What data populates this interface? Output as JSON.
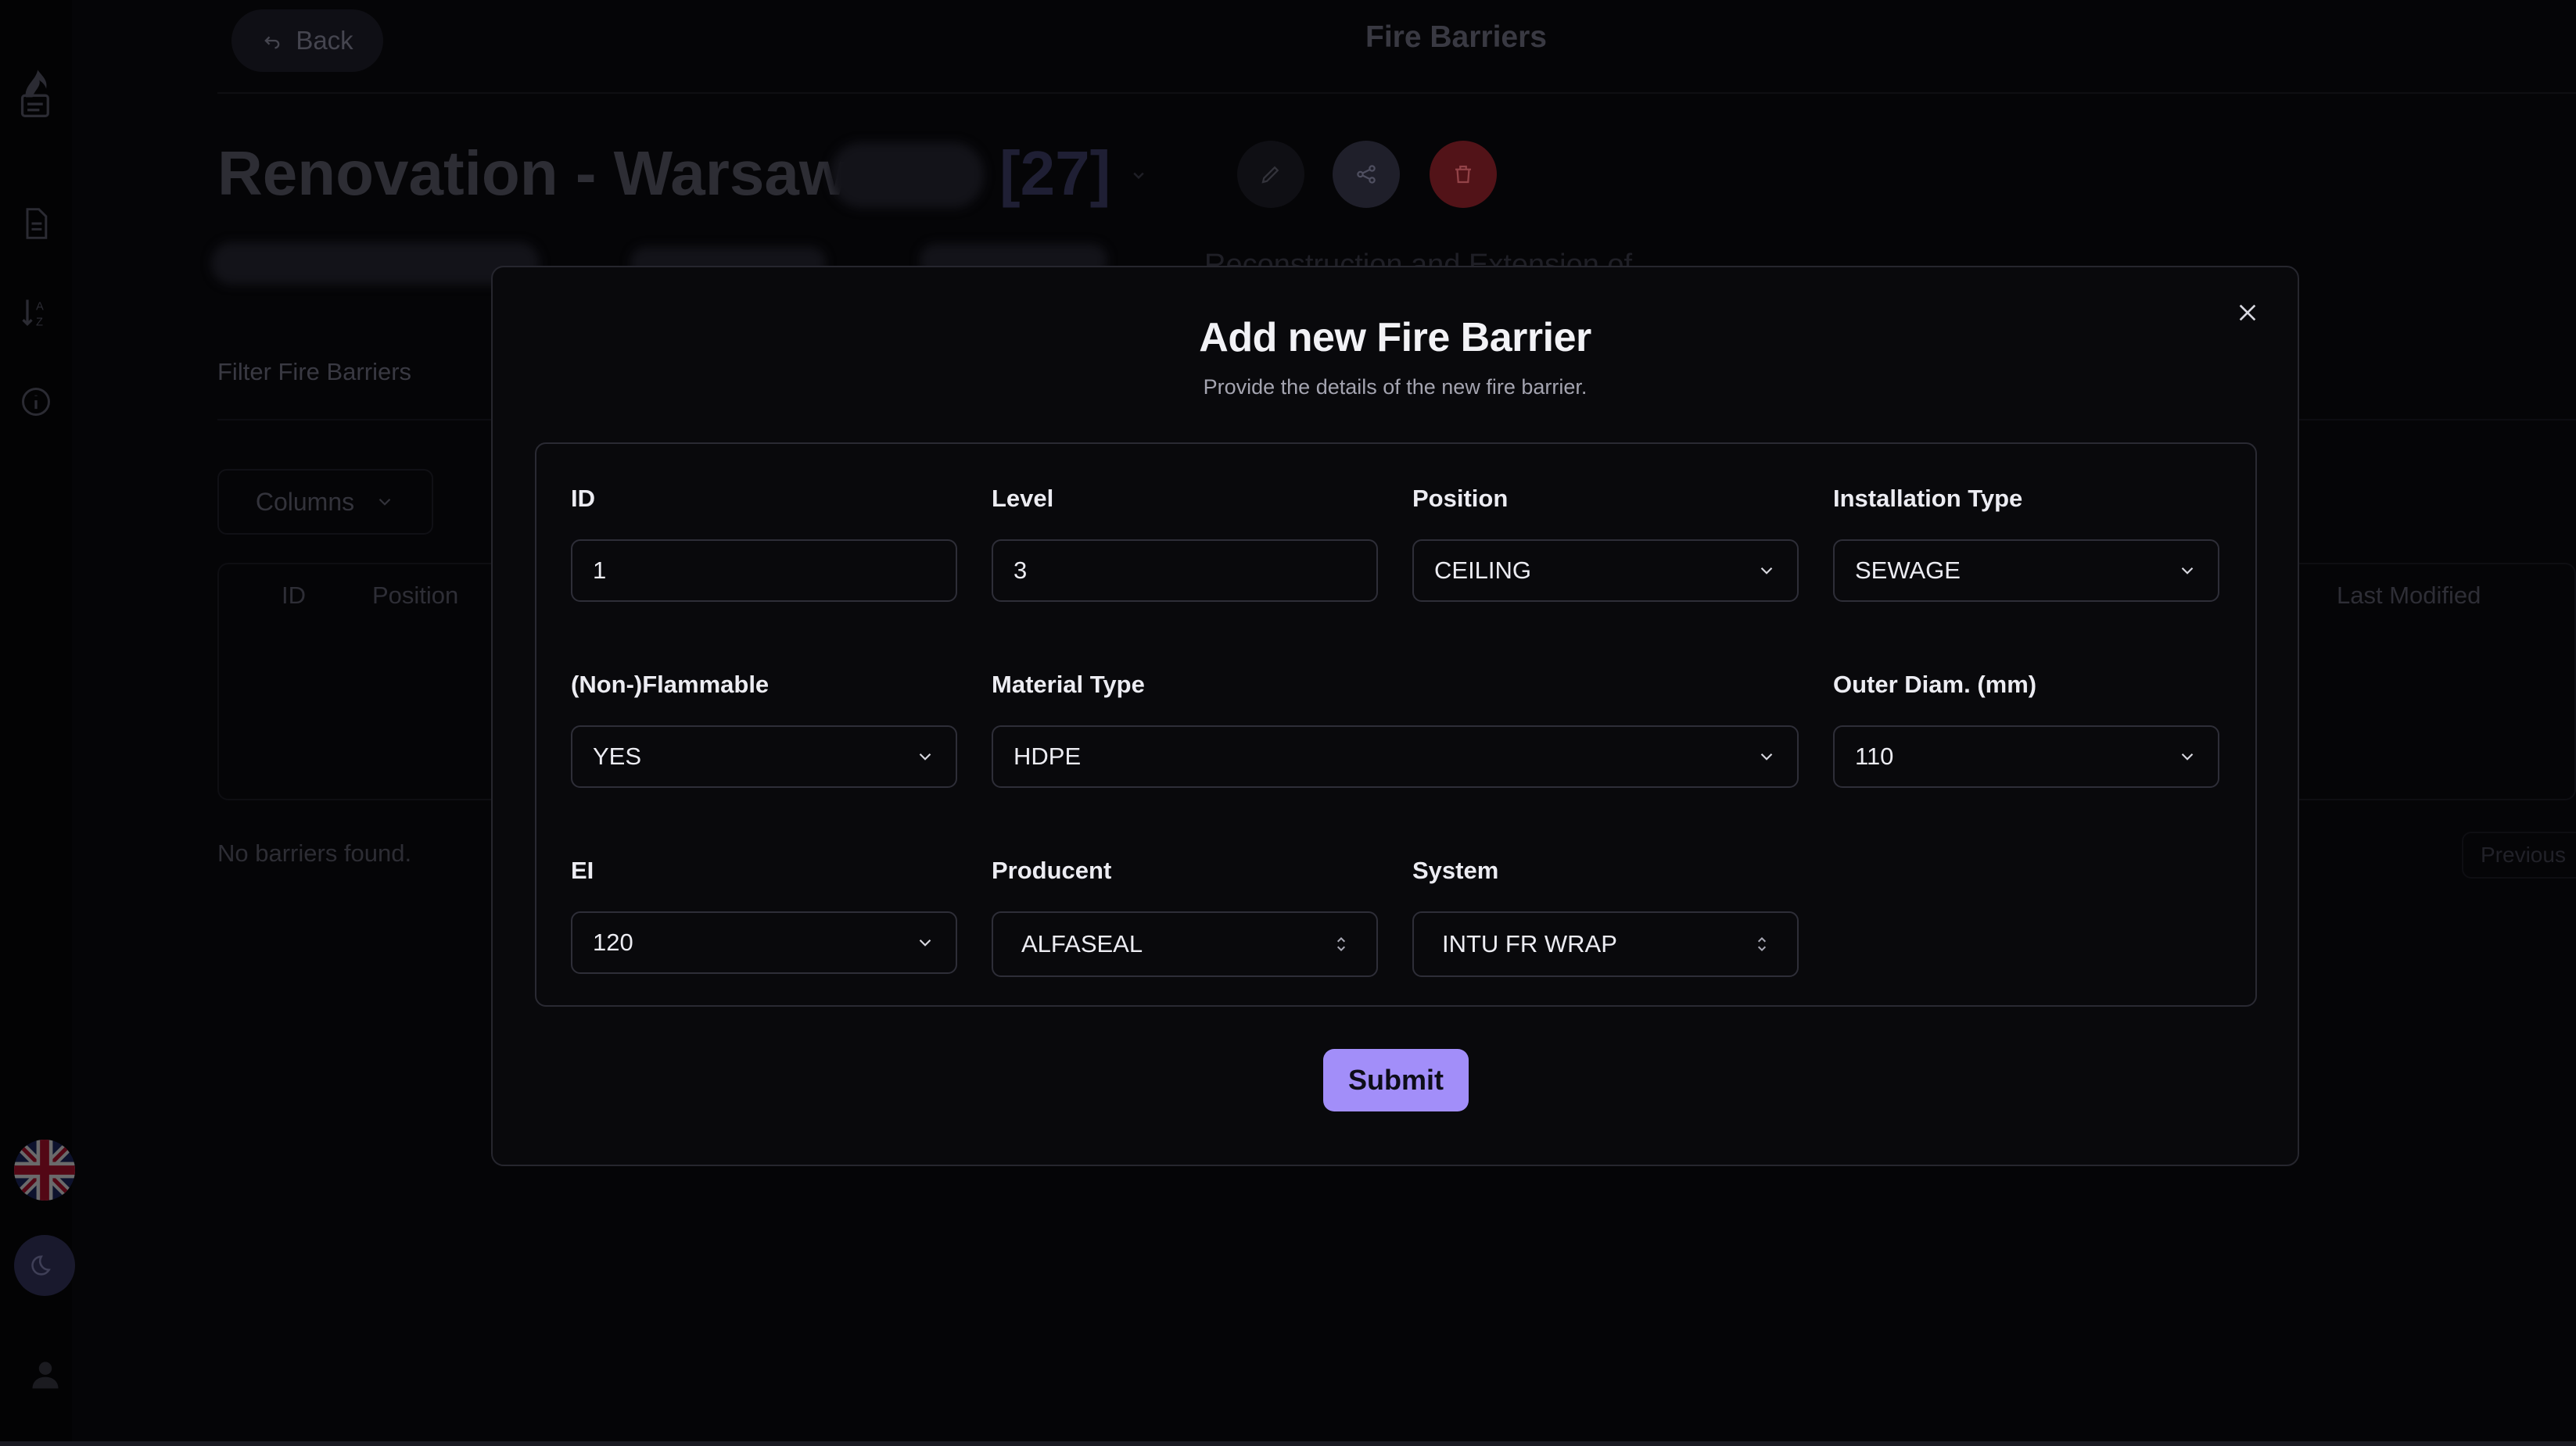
{
  "header": {
    "back_label": "Back",
    "title": "Fire Barriers"
  },
  "project": {
    "name": "Renovation - Warsaw",
    "count": "[27]",
    "subtitle": "Reconstruction and Extension of"
  },
  "list": {
    "filter_label": "Filter Fire Barriers",
    "columns_label": "Columns",
    "columns": [
      "ID",
      "Position",
      "Last Modified"
    ],
    "empty_text": "No barriers found.",
    "previous_label": "Previous"
  },
  "modal": {
    "title": "Add new Fire Barrier",
    "description": "Provide the details of the new fire barrier.",
    "submit_label": "Submit",
    "fields": {
      "id": {
        "label": "ID",
        "value": "1"
      },
      "level": {
        "label": "Level",
        "value": "3"
      },
      "position": {
        "label": "Position",
        "value": "CEILING"
      },
      "installation_type": {
        "label": "Installation Type",
        "value": "SEWAGE"
      },
      "flammable": {
        "label": "(Non-)Flammable",
        "value": "YES"
      },
      "material_type": {
        "label": "Material Type",
        "value": "HDPE"
      },
      "outer_diam": {
        "label": "Outer Diam. (mm)",
        "value": "110"
      },
      "ei": {
        "label": "EI",
        "value": "120"
      },
      "producent": {
        "label": "Producent",
        "value": "ALFASEAL"
      },
      "system": {
        "label": "System",
        "value": "INTU FR WRAP"
      }
    }
  },
  "icons": {
    "logo": "flame-document-icon",
    "nav_1": "document-icon",
    "nav_2": "sort-az-icon",
    "nav_3": "info-icon",
    "language": "uk-flag-icon",
    "theme": "moon-icon",
    "user": "user-icon"
  },
  "colors": {
    "accent": "#a28ef9",
    "delete": "#8b1d24",
    "background": "#07070a"
  }
}
